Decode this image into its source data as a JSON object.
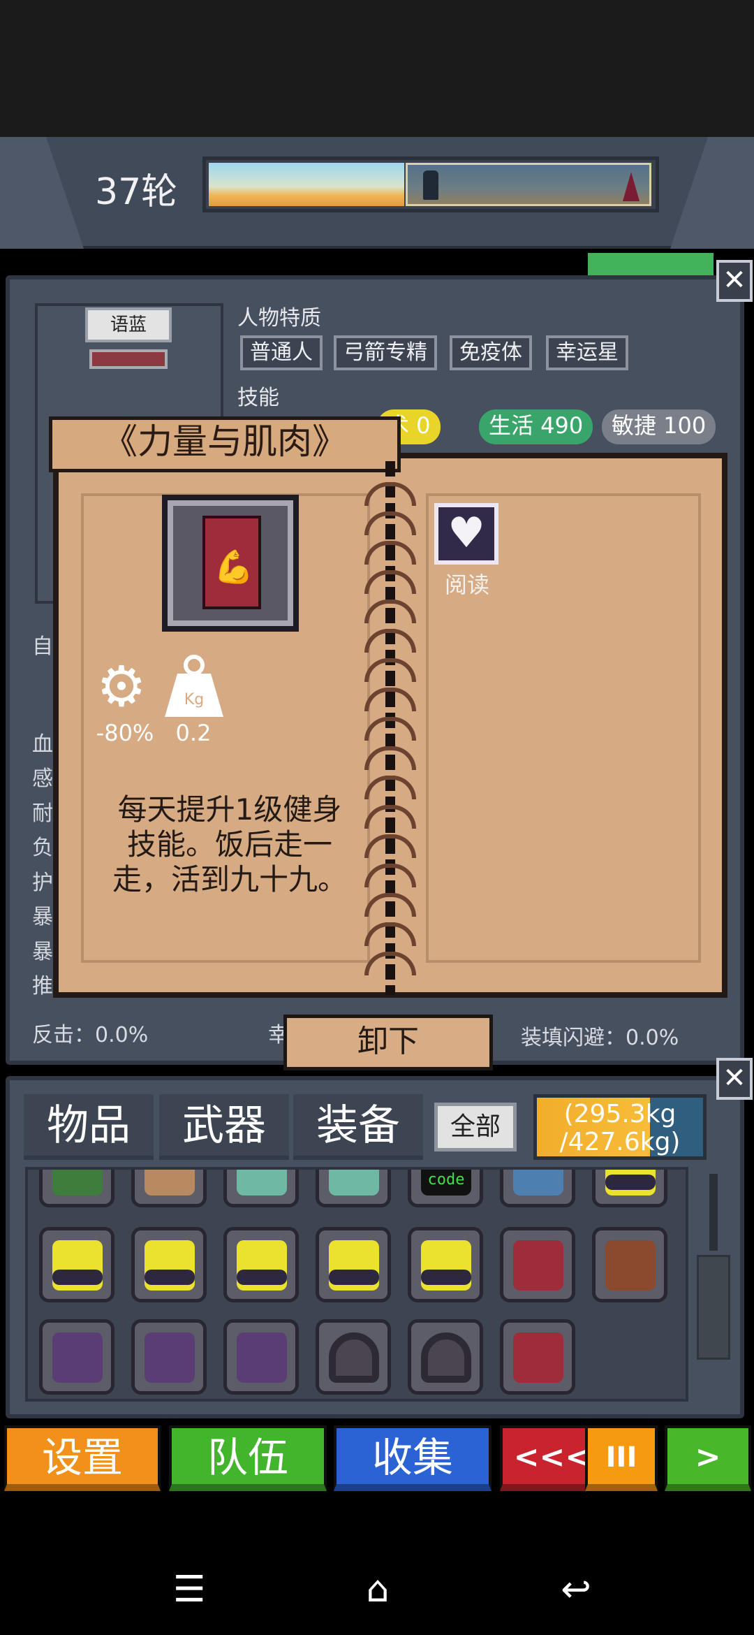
{
  "top_bar": {
    "round_label": "37轮"
  },
  "character": {
    "name": "语蓝",
    "traits_title": "人物特质",
    "traits": [
      "普通人",
      "弓箭专精",
      "免疫体",
      "幸运星"
    ],
    "skills_title": "技能",
    "skills": [
      {
        "label": "术 0",
        "color": "#e9d42a"
      },
      {
        "label": "生活 490",
        "color": "#3aa56a"
      },
      {
        "label": "敏捷 100",
        "color": "#7a7f89"
      }
    ],
    "side_labels": [
      "自",
      "血",
      "感",
      "耐",
      "负",
      "护",
      "暴",
      "暴",
      "推"
    ],
    "stat_counter": "反击：0.0%",
    "stat_mid": "幸",
    "stat_dodge": "装填闪避：0.0%"
  },
  "book_popup": {
    "title": "《力量与肌肉》",
    "action_icon": "heart-icon",
    "action_label": "阅读",
    "durability_value": "-80%",
    "weight_value": "0.2",
    "weight_unit": "Kg",
    "description_lines": [
      "每天提升1级健身",
      "技能。饭后走一",
      "走，活到九十九。"
    ],
    "unequip_label": "卸下"
  },
  "inventory": {
    "tabs": [
      "物品",
      "武器",
      "装备"
    ],
    "filter_all": "全部",
    "weight_line1": "(295.3kg",
    "weight_line2": "/427.6kg)",
    "weight_fill_fraction": 0.69,
    "row0_partial": [
      "door",
      "dagger",
      "sneaker",
      "sneaker",
      "code",
      "laptop",
      "goggles-helmet"
    ],
    "row0_code_text": "code",
    "row1": [
      "goggles-helmet",
      "goggles-helmet",
      "goggles-helmet",
      "goggles-helmet",
      "goggles-helmet",
      "red-book-cross",
      "gem-book"
    ],
    "row2": [
      "armor-vest",
      "armor-vest",
      "armor-vest",
      "headphones",
      "headphones",
      "strength-book"
    ]
  },
  "bottom_buttons": [
    {
      "label": "设置",
      "color": "#f1901a"
    },
    {
      "label": "队伍",
      "color": "#43b52d"
    },
    {
      "label": "收集",
      "color": "#2b62d4"
    },
    {
      "label": "<<<",
      "color": "#c9232d"
    },
    {
      "label": "III",
      "color": "#f59a11"
    },
    {
      "label": ">",
      "color": "#48b82a"
    }
  ],
  "close_label": "✕"
}
